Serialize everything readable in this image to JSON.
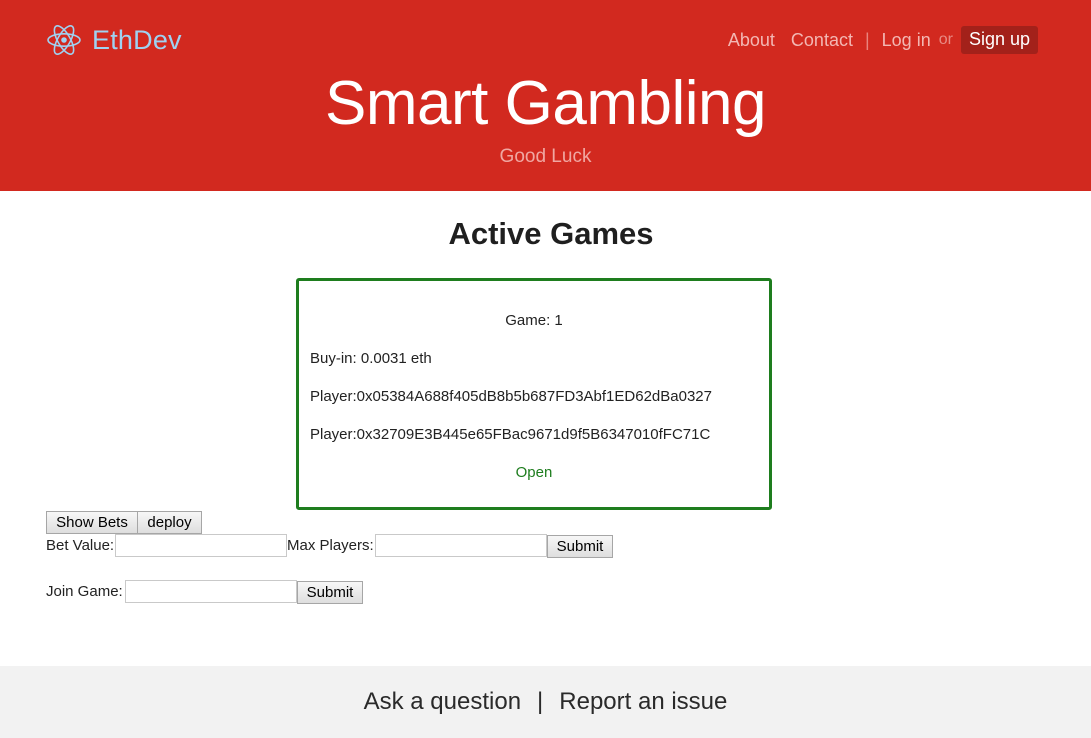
{
  "header": {
    "brand": "EthDev",
    "nav": {
      "about": "About",
      "contact": "Contact",
      "separator": "|",
      "login": "Log in",
      "or": "or",
      "signup": "Sign up"
    },
    "title": "Smart Gambling",
    "subtitle": "Good Luck"
  },
  "main": {
    "section_title": "Active Games",
    "game": {
      "title": "Game: 1",
      "buy_in": "Buy-in: 0.0031 eth",
      "players": [
        "Player:0x05384A688f405dB8b5b687FD3Abf1ED62dBa0327",
        "Player:0x32709E3B445e65FBac9671d9f5B6347010fFC71C"
      ],
      "status": "Open"
    },
    "buttons": {
      "show_bets": "Show Bets",
      "deploy": "deploy"
    },
    "create_form": {
      "bet_value_label": "Bet Value:",
      "bet_value": "",
      "max_players_label": "Max Players:",
      "max_players": "",
      "submit": "Submit"
    },
    "join_form": {
      "label": "Join Game:",
      "value": "",
      "submit": "Submit"
    }
  },
  "footer": {
    "ask": "Ask a question",
    "separator": "|",
    "report": "Report an issue"
  },
  "colors": {
    "header_bg": "#d2291f",
    "brand": "#9fd2f2",
    "status_green": "#1e7d1e",
    "footer_bg": "#f2f2f2"
  },
  "icons": {
    "brand": "react-atom-icon"
  }
}
